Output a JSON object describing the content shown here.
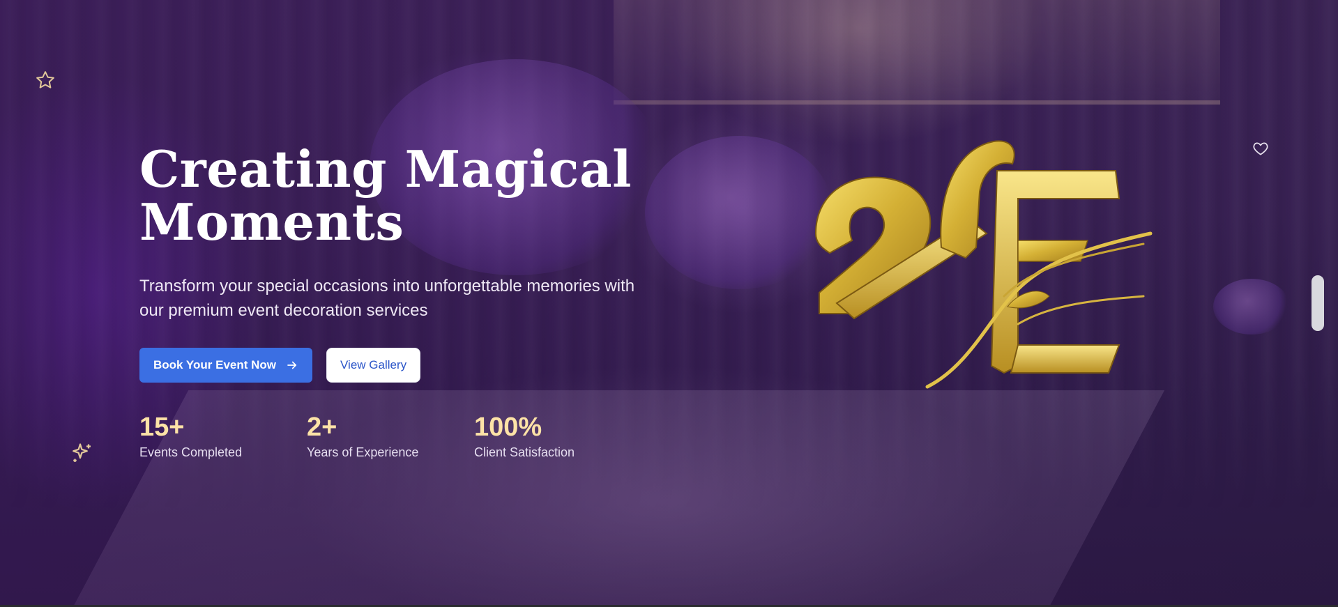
{
  "hero": {
    "headline_line1": "Creating Magical",
    "headline_line2": "Moments",
    "subtitle": "Transform your special occasions into unforgettable memories with our premium event decoration services",
    "primary_button": "Book Your Event Now",
    "secondary_button": "View Gallery",
    "stats": [
      {
        "value": "15+",
        "label": "Events Completed"
      },
      {
        "value": "2+",
        "label": "Years of Experience"
      },
      {
        "value": "100%",
        "label": "Client Satisfaction"
      }
    ]
  },
  "icons": {
    "star": "star-icon",
    "sparkles": "sparkles-icon",
    "heart": "heart-icon",
    "arrow": "arrow-right-icon",
    "logo": "brand-logo"
  },
  "colors": {
    "accent_blue": "#3b6fe3",
    "stat_gold": "#fde3a7",
    "logo_gold": "#d4b035",
    "overlay_purple": "#3a165c"
  }
}
